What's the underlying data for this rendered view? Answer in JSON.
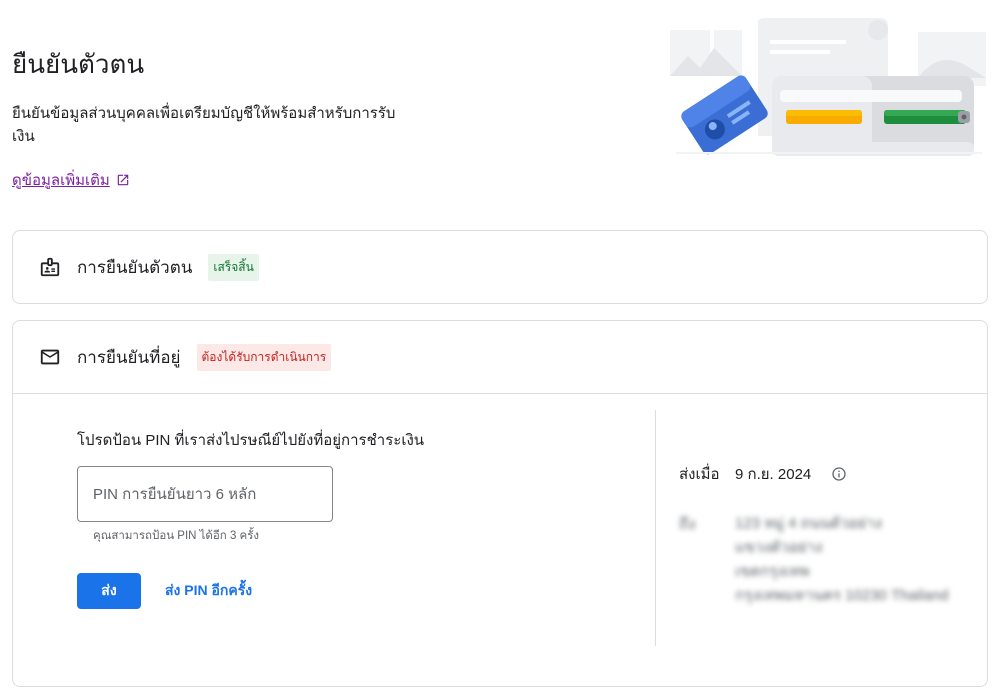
{
  "page": {
    "title": "ยืนยันตัวตน",
    "description": "ยืนยันข้อมูลส่วนบุคคลเพื่อเตรียมบัญชีให้พร้อมสำหรับการรับเงิน",
    "learn_more": "ดูข้อมูลเพิ่มเติม"
  },
  "identity_card": {
    "title": "การยืนยันตัวตน",
    "status": "เสร็จสิ้น",
    "icon": "id-badge-icon"
  },
  "address_card": {
    "title": "การยืนยันที่อยู่",
    "status": "ต้องได้รับการดำเนินการ",
    "icon": "mail-icon",
    "instruction": "โปรดป้อน PIN ที่เราส่งไปรษณีย์ไปยังที่อยู่การชำระเงิน",
    "pin_placeholder": "PIN การยืนยันยาว 6 หลัก",
    "pin_value": "",
    "helper": "คุณสามารถป้อน PIN ได้อีก 3 ครั้ง",
    "send_label": "ส่ง",
    "resend_label": "ส่ง PIN อีกครั้ง",
    "sent_label": "ส่งเมื่อ",
    "sent_date": "9 ก.ย. 2024",
    "address_label": "ถึง",
    "address_lines": [
      "123 หมู่ 4 ถนนตัวอย่าง",
      "แขวงตัวอย่าง",
      "เขตกรุงเทพ",
      "กรุงเทพมหานคร 10230 Thailand"
    ]
  },
  "colors": {
    "primary": "#1a73e8",
    "link": "#7b1fa2",
    "success_bg": "#e6f4ea",
    "success_text": "#137333",
    "warning_bg": "#fce8e6",
    "warning_text": "#c5221f"
  }
}
